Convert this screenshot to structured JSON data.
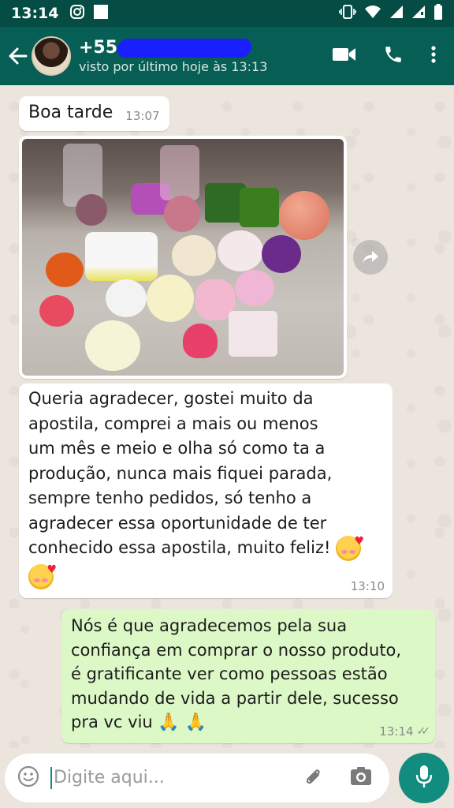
{
  "status_bar": {
    "time": "13:14"
  },
  "header": {
    "contact_name": "+55",
    "last_seen": "visto por último hoje às 13:13"
  },
  "messages": [
    {
      "direction": "incoming",
      "type": "text",
      "text": "Boa tarde",
      "time": "13:07"
    },
    {
      "direction": "incoming",
      "type": "image"
    },
    {
      "direction": "incoming",
      "type": "text",
      "lines": [
        "Queria agradecer, gostei muito da",
        "apostila, comprei a mais ou menos",
        "um mês e meio e olha só como ta a",
        "produção, nunca mais fiquei parada,",
        "sempre tenho pedidos, só tenho a",
        "agradecer essa oportunidade de ter",
        "conhecido essa apostila, muito feliz!"
      ],
      "time": "13:10"
    },
    {
      "direction": "outgoing",
      "type": "text",
      "lines": [
        "Nós é que agradecemos pela sua",
        "confiança em comprar o nosso produto,",
        "é gratificante ver como pessoas estão",
        "mudando de vida a partir dele, sucesso",
        "pra vc viu"
      ],
      "time": "13:14",
      "status": "read"
    }
  ],
  "input": {
    "placeholder": "Digite aqui..."
  },
  "icons": {
    "status_left": [
      "instagram-icon",
      "notification-square-icon"
    ],
    "status_right": [
      "vibrate-icon",
      "wifi-icon",
      "signal-icon",
      "signal-icon",
      "battery-icon"
    ],
    "header": [
      "back-arrow-icon",
      "video-call-icon",
      "phone-icon",
      "more-vert-icon"
    ],
    "input": [
      "emoji-icon",
      "attach-icon",
      "camera-icon",
      "mic-icon"
    ]
  },
  "colors": {
    "header": "#075e54",
    "status_bar": "#054d44",
    "incoming_bubble": "#ffffff",
    "outgoing_bubble": "#dcf8c6",
    "accent": "#128c7e"
  }
}
